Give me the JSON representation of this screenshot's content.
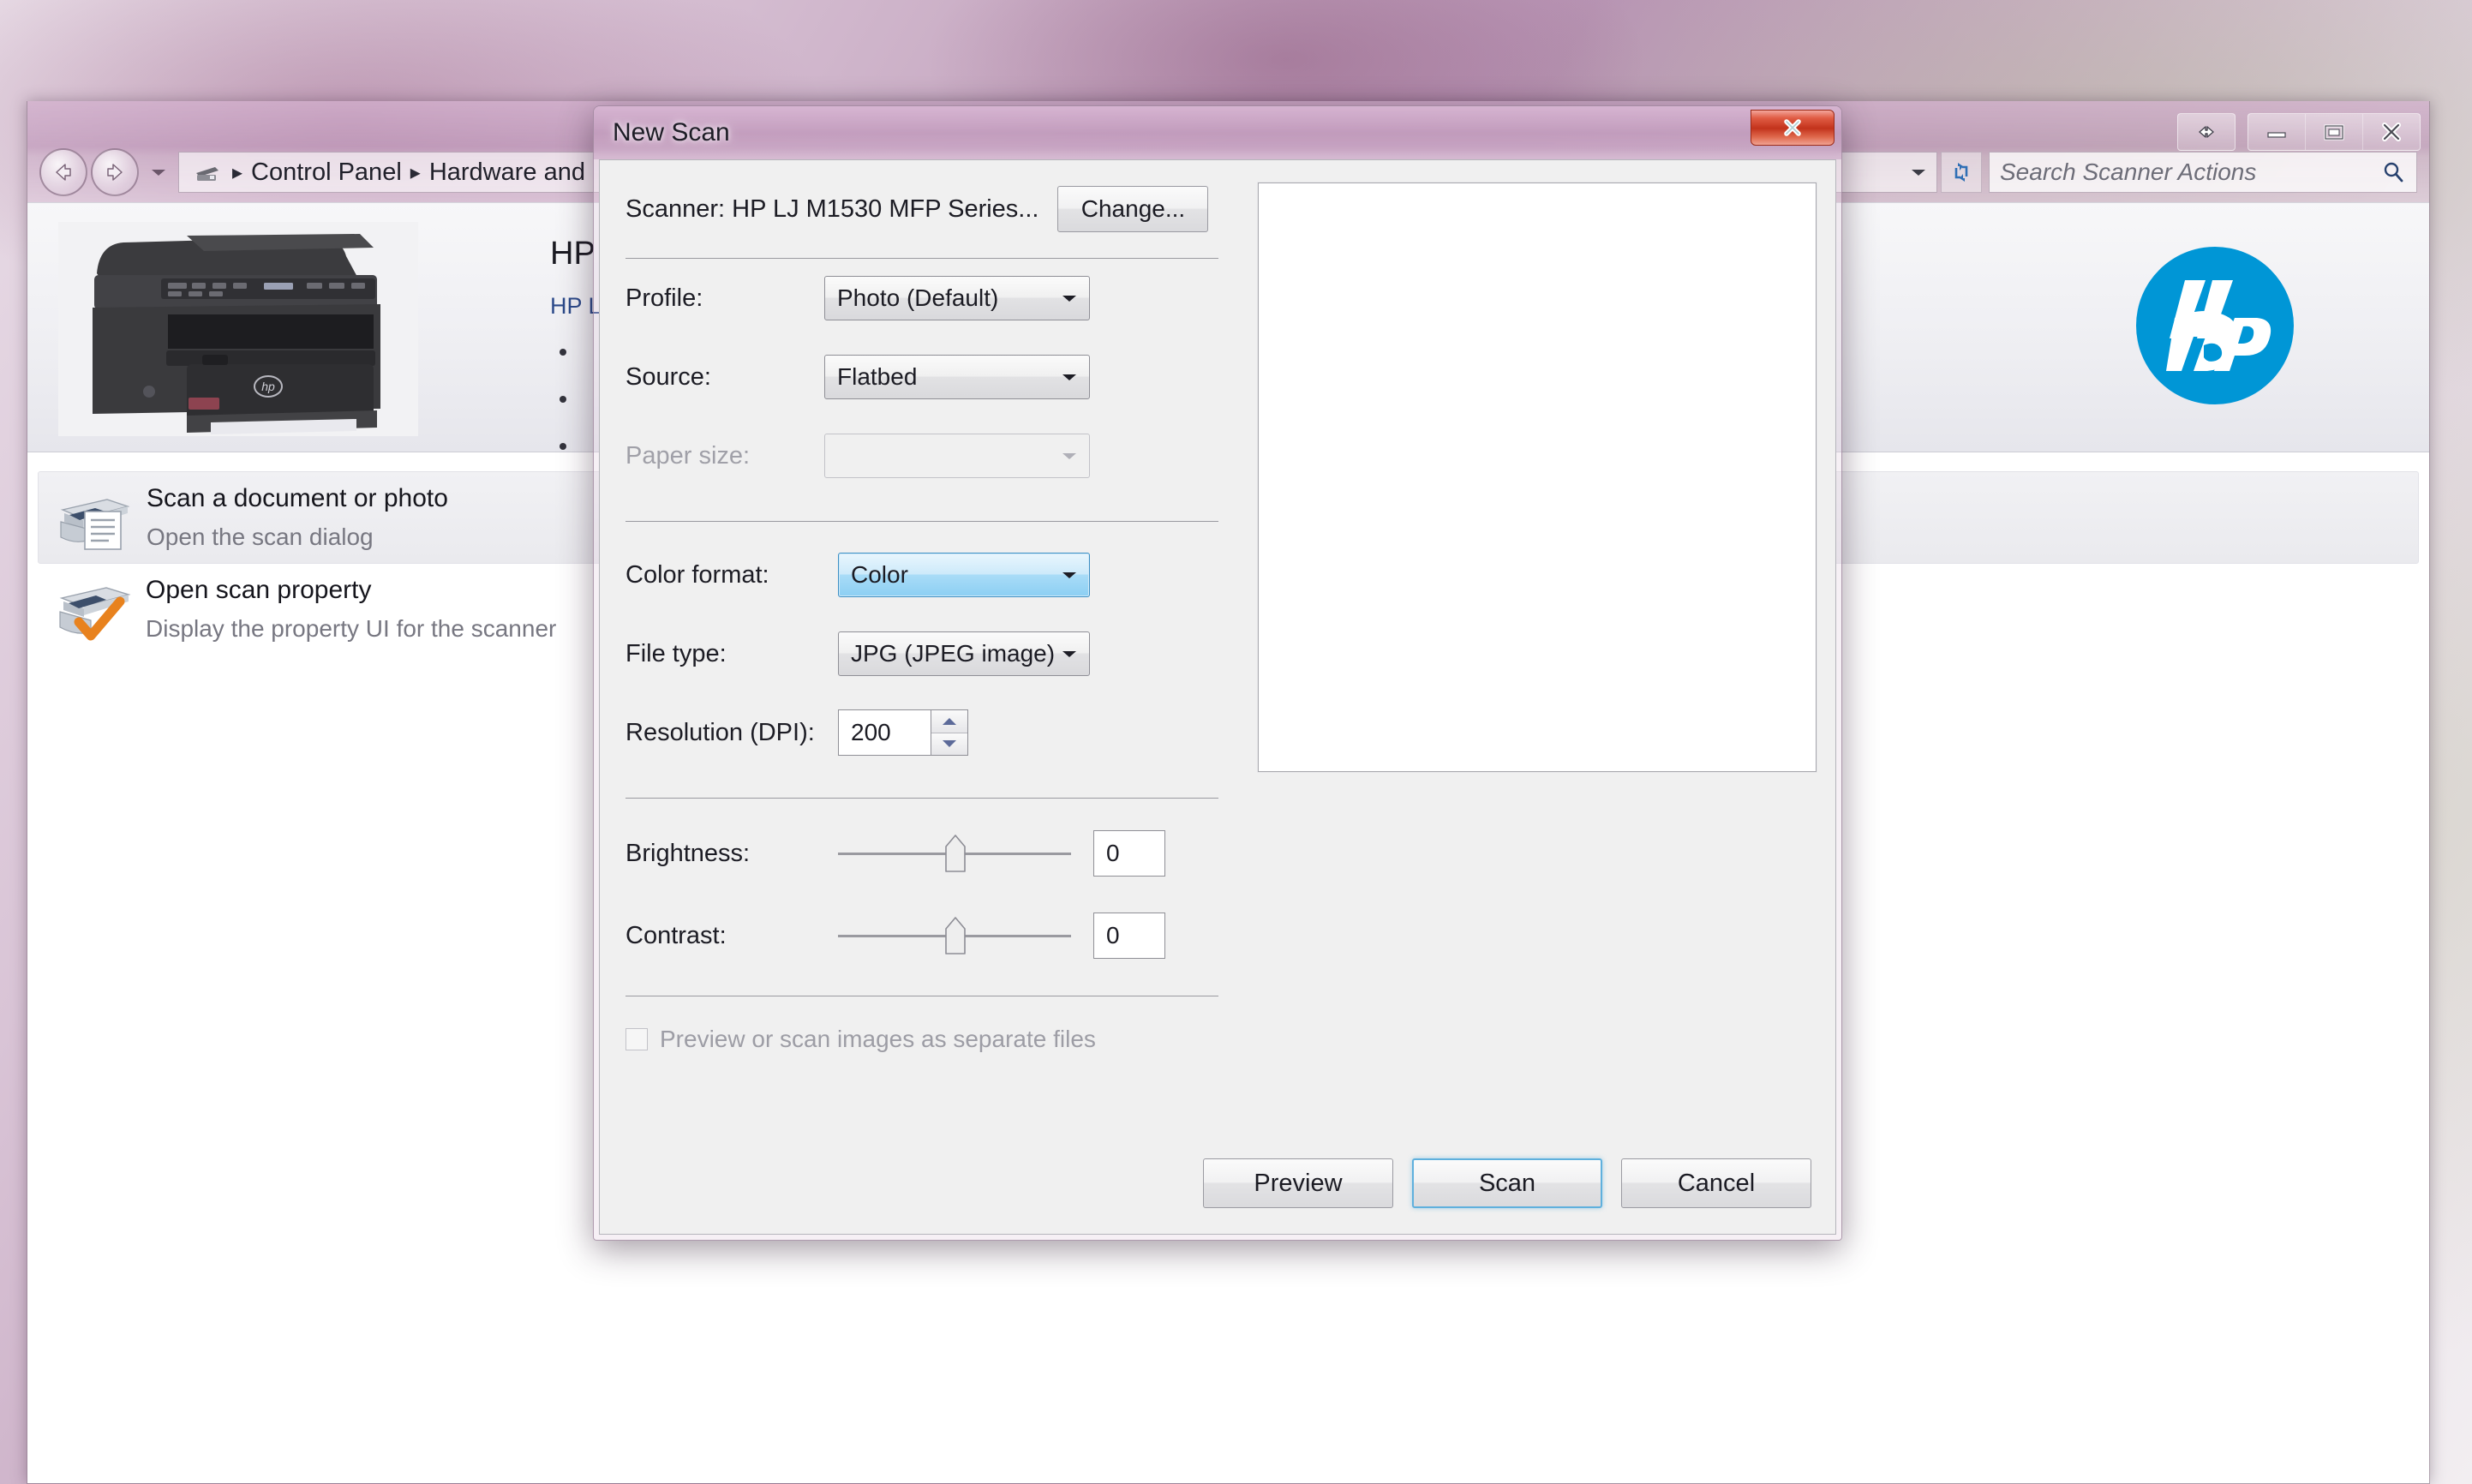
{
  "explorer": {
    "nav": {
      "back_icon": "arrow-left-icon",
      "forward_icon": "arrow-right-icon",
      "history_icon": "chevron-down-icon",
      "refresh_icon": "refresh-icon"
    },
    "address": {
      "device_icon": "printer-icon",
      "crumbs": [
        "Control Panel",
        "Hardware and"
      ],
      "separator": "▸",
      "dropdown_icon": "chevron-down-icon"
    },
    "search": {
      "placeholder": "Search Scanner Actions",
      "icon": "search-icon"
    },
    "caption": {
      "help_icon": "resize-arrows-icon",
      "minimize_icon": "minimize-icon",
      "maximize_icon": "maximize-icon",
      "close_icon": "close-icon"
    },
    "device": {
      "title": "HP",
      "subtitle": "HP L",
      "bullets": [
        "",
        "",
        ""
      ],
      "photo_name": "hp-printer-photo",
      "logo_name": "hp-logo",
      "logo_color": "#0096D6"
    },
    "tasks": [
      {
        "title": "Scan a document or photo",
        "description": "Open the scan dialog",
        "icon": "scanner-document-icon"
      },
      {
        "title": "Open scan property",
        "description": "Display the property UI for the scanner",
        "icon": "scanner-check-icon"
      }
    ]
  },
  "dialog": {
    "title": "New Scan",
    "close_icon": "close-icon",
    "scanner": {
      "label": "Scanner: HP LJ M1530 MFP Series...",
      "change_button": "Change..."
    },
    "fields": {
      "profile_label": "Profile:",
      "profile_value": "Photo (Default)",
      "source_label": "Source:",
      "source_value": "Flatbed",
      "paper_size_label": "Paper size:",
      "paper_size_value": "",
      "color_format_label": "Color format:",
      "color_format_value": "Color",
      "file_type_label": "File type:",
      "file_type_value": "JPG (JPEG image)",
      "resolution_label": "Resolution (DPI):",
      "resolution_value": "200",
      "brightness_label": "Brightness:",
      "brightness_value": "0",
      "contrast_label": "Contrast:",
      "contrast_value": "0"
    },
    "checkbox": {
      "label": "Preview or scan images as separate files",
      "checked": false
    },
    "buttons": {
      "preview": "Preview",
      "scan": "Scan",
      "cancel": "Cancel"
    },
    "preview_pane_name": "scan-preview-pane",
    "focus_color": "#5fb0dd"
  }
}
